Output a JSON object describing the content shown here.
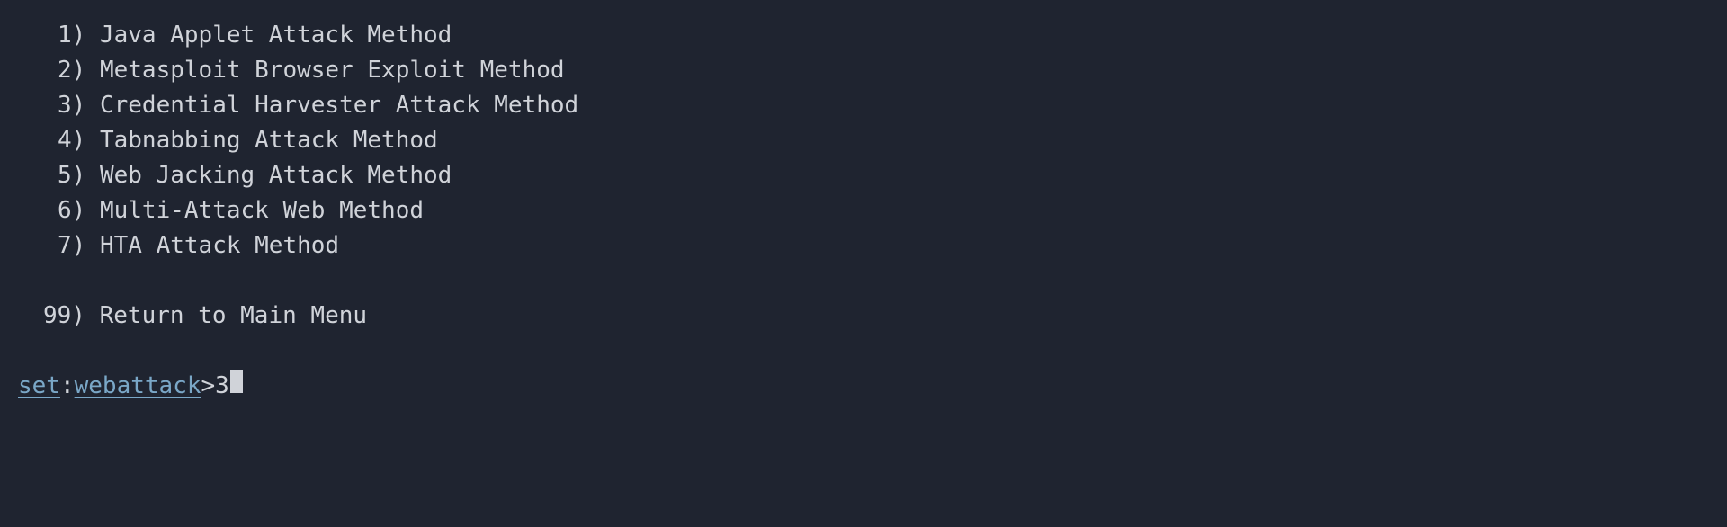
{
  "menu": {
    "items": [
      {
        "num": "1)",
        "label": "Java Applet Attack Method"
      },
      {
        "num": "2)",
        "label": "Metasploit Browser Exploit Method"
      },
      {
        "num": "3)",
        "label": "Credential Harvester Attack Method"
      },
      {
        "num": "4)",
        "label": "Tabnabbing Attack Method"
      },
      {
        "num": "5)",
        "label": "Web Jacking Attack Method"
      },
      {
        "num": "6)",
        "label": "Multi-Attack Web Method"
      },
      {
        "num": "7)",
        "label": "HTA Attack Method"
      }
    ],
    "return_item": {
      "num": "99)",
      "label": "Return to Main Menu"
    }
  },
  "prompt": {
    "segment1": "set",
    "separator": ":",
    "segment2": "webattack",
    "chevron": ">",
    "input_value": "3"
  }
}
